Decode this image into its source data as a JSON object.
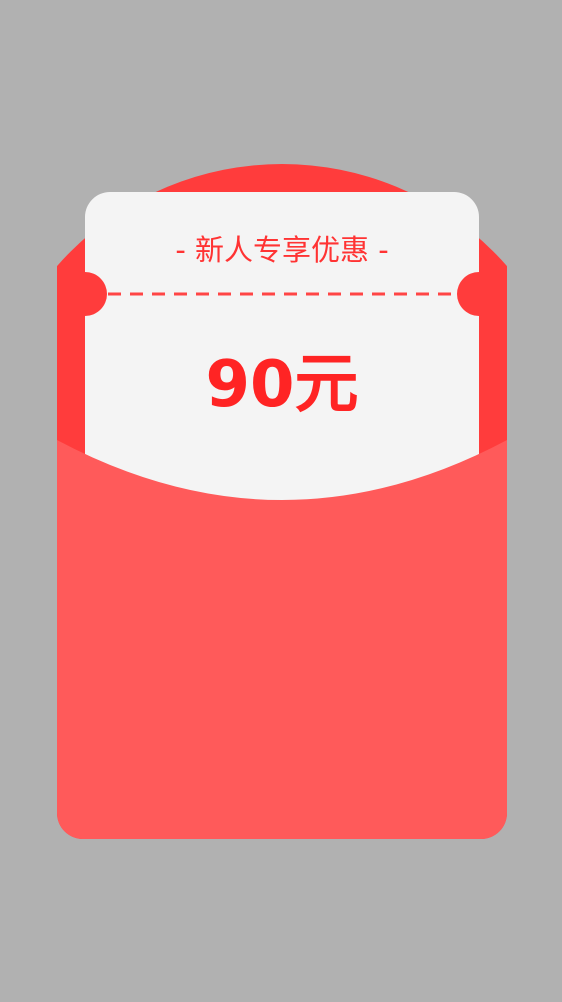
{
  "coupon": {
    "title": "- 新人专享优惠 -",
    "amount": "90元"
  },
  "colors": {
    "background": "#b1b1b1",
    "envelope_back": "#ff3c3c",
    "envelope_front": "#ff5a5a",
    "ticket": "#f4f4f4",
    "text": "#ff2424"
  }
}
